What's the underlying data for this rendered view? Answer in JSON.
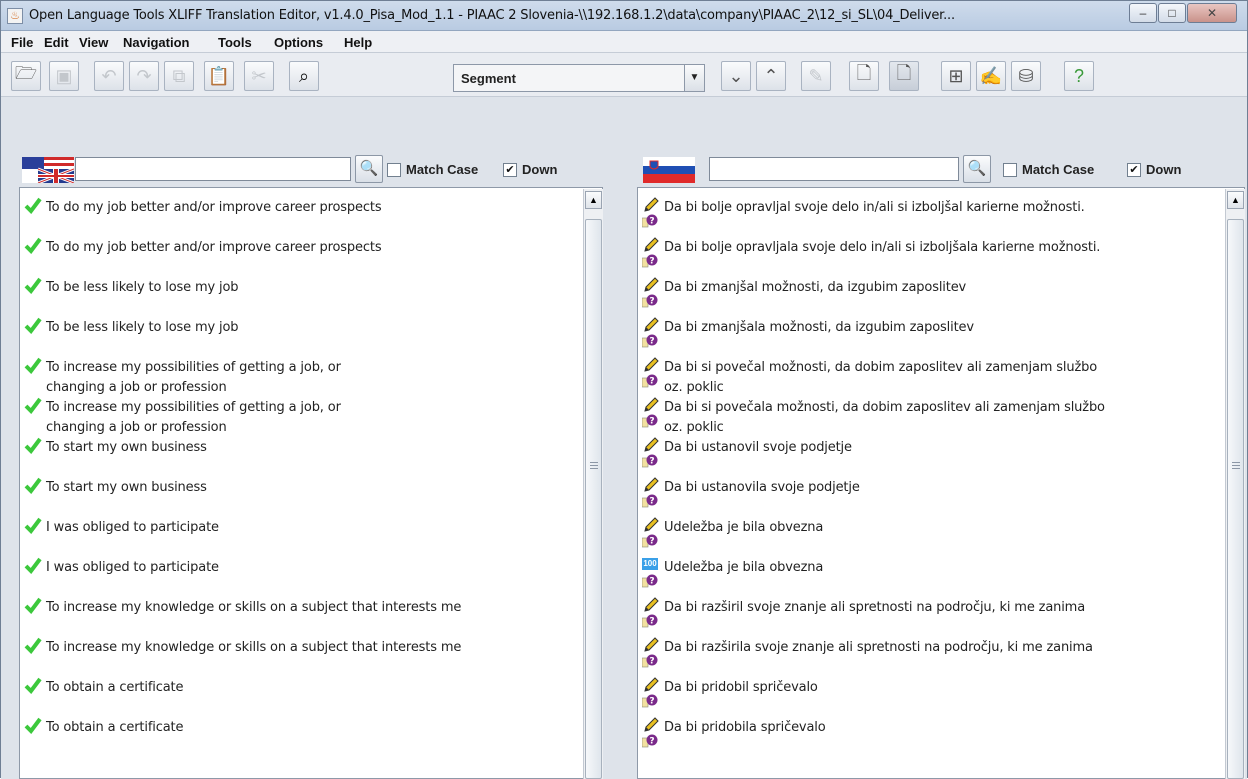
{
  "window": {
    "title": "Open Language Tools XLIFF Translation Editor, v1.4.0_Pisa_Mod_1.1 - PIAAC 2 Slovenia-\\\\192.168.1.2\\data\\company\\PIAAC_2\\12_si_SL\\04_Deliver...",
    "min_label": "–",
    "max_label": "□",
    "close_label": "✕"
  },
  "menu": [
    "File",
    "Edit",
    "View",
    "Navigation",
    "Tools",
    "Options",
    "Help"
  ],
  "toolbar": {
    "search_mode": "Segment"
  },
  "search_left": {
    "value": "",
    "match_case_label": "Match Case",
    "match_case_checked": false,
    "down_label": "Down",
    "down_checked": true
  },
  "search_right": {
    "value": "",
    "match_case_label": "Match Case",
    "match_case_checked": false,
    "down_label": "Down",
    "down_checked": true
  },
  "source_segments": [
    "To do my job better and/or improve career prospects",
    "To do my job better and/or improve career prospects",
    "To be less likely to lose my job",
    "To be less likely to lose my job",
    "To increase my possibilities of getting a job, or\nchanging a job or profession",
    "To increase my possibilities of getting a job, or\nchanging a job or profession",
    "To start my own business",
    "To start my own business",
    "I was obliged to participate",
    "I was obliged to participate",
    "To increase my knowledge or skills on a subject that interests me",
    "To increase my knowledge or skills on a subject that interests me",
    "To obtain a certificate",
    "To obtain a certificate"
  ],
  "target_segments": [
    {
      "text": "Da bi bolje opravljal svoje delo in/ali si izboljšal karierne možnosti.",
      "status": "edited"
    },
    {
      "text": "Da bi bolje opravljala svoje delo in/ali si izboljšala karierne možnosti.",
      "status": "edited"
    },
    {
      "text": "Da bi zmanjšal možnosti, da izgubim zaposlitev",
      "status": "edited"
    },
    {
      "text": "Da bi zmanjšala možnosti, da izgubim zaposlitev",
      "status": "edited"
    },
    {
      "text": "Da bi si povečal možnosti, da dobim zaposlitev ali zamenjam službo\noz. poklic",
      "status": "edited"
    },
    {
      "text": "Da bi si povečala možnosti, da dobim zaposlitev ali zamenjam službo\noz. poklic",
      "status": "edited"
    },
    {
      "text": "Da bi ustanovil svoje podjetje",
      "status": "edited"
    },
    {
      "text": "Da bi ustanovila svoje podjetje",
      "status": "edited"
    },
    {
      "text": "Udeležba je bila obvezna",
      "status": "edited"
    },
    {
      "text": "Udeležba je bila obvezna",
      "status": "exact-match"
    },
    {
      "text": "Da bi razširil svoje znanje ali spretnosti na področju, ki me zanima",
      "status": "edited"
    },
    {
      "text": "Da bi razširila svoje znanje ali spretnosti na področju, ki me zanima",
      "status": "edited"
    },
    {
      "text": "Da bi pridobil spričevalo",
      "status": "edited"
    },
    {
      "text": "Da bi pridobila spričevalo",
      "status": "edited"
    }
  ],
  "exact_match_badge": "100",
  "colors": {
    "approved_check": "#3cc83c",
    "edit_pencil": "#e8c020",
    "question_mark": "#7a2a8a",
    "exact_match": "#3aa0e8"
  }
}
